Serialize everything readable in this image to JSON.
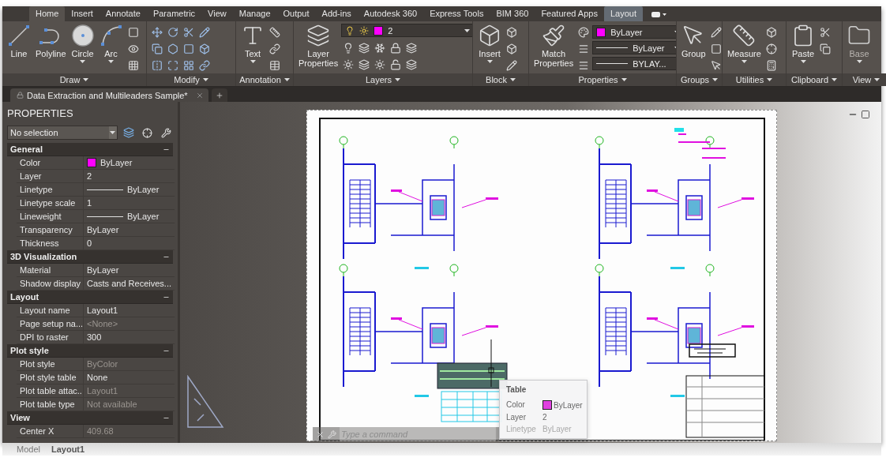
{
  "menu_tabs": [
    {
      "label": "Home",
      "selected": true,
      "kind": "standard"
    },
    {
      "label": "Insert",
      "selected": false,
      "kind": "standard"
    },
    {
      "label": "Annotate",
      "selected": false,
      "kind": "standard"
    },
    {
      "label": "Parametric",
      "selected": false,
      "kind": "standard"
    },
    {
      "label": "View",
      "selected": false,
      "kind": "standard"
    },
    {
      "label": "Manage",
      "selected": false,
      "kind": "standard"
    },
    {
      "label": "Output",
      "selected": false,
      "kind": "standard"
    },
    {
      "label": "Add-ins",
      "selected": false,
      "kind": "standard"
    },
    {
      "label": "Autodesk 360",
      "selected": false,
      "kind": "standard"
    },
    {
      "label": "Express Tools",
      "selected": false,
      "kind": "standard"
    },
    {
      "label": "BIM 360",
      "selected": false,
      "kind": "standard"
    },
    {
      "label": "Featured Apps",
      "selected": false,
      "kind": "standard"
    },
    {
      "label": "Layout",
      "selected": false,
      "kind": "contextual"
    }
  ],
  "ribbon_panels": [
    {
      "title": "Draw",
      "tools": [
        {
          "label": "Line"
        },
        {
          "label": "Polyline"
        },
        {
          "label": "Circle",
          "dropdown": true
        },
        {
          "label": "Arc",
          "dropdown": true
        }
      ]
    },
    {
      "title": "Modify"
    },
    {
      "title": "Annotation",
      "tools": [
        {
          "label": "Text",
          "dropdown": true
        }
      ]
    },
    {
      "title": "Layers",
      "tools": [
        {
          "label": "Layer Properties"
        }
      ],
      "layer_dropdown": {
        "value": "2",
        "color": "#ff00ff"
      }
    },
    {
      "title": "Block",
      "tools": [
        {
          "label": "Insert",
          "dropdown": true
        }
      ]
    },
    {
      "title": "Properties",
      "tools": [
        {
          "label": "Match Properties"
        }
      ],
      "dropdowns": [
        {
          "kind": "color",
          "value": "ByLayer",
          "color": "#ff00ff"
        },
        {
          "kind": "line",
          "value": "ByLayer"
        },
        {
          "kind": "line",
          "value": "BYLAY..."
        }
      ]
    },
    {
      "title": "Groups",
      "tools": [
        {
          "label": "Group"
        }
      ]
    },
    {
      "title": "Utilities",
      "tools": [
        {
          "label": "Measure",
          "dropdown": true
        }
      ]
    },
    {
      "title": "Clipboard",
      "tools": [
        {
          "label": "Paste",
          "dropdown": true
        }
      ]
    },
    {
      "title": "View",
      "tools": [
        {
          "label": "Base",
          "dropdown": true
        }
      ]
    }
  ],
  "document_tabs": [
    {
      "label": "Data Extraction and Multileaders Sample*",
      "selected": true
    }
  ],
  "properties": {
    "title": "PROPERTIES",
    "selection": "No selection",
    "sections": [
      {
        "title": "General",
        "expanded": true,
        "rows": [
          {
            "name": "Color",
            "value": "ByLayer",
            "kind": "color",
            "color": "#ff00ff",
            "disabled": false
          },
          {
            "name": "Layer",
            "value": "2",
            "kind": "text",
            "disabled": false
          },
          {
            "name": "Linetype",
            "value": "ByLayer",
            "kind": "line",
            "disabled": false
          },
          {
            "name": "Linetype scale",
            "value": "1",
            "kind": "text",
            "disabled": false
          },
          {
            "name": "Lineweight",
            "value": "ByLayer",
            "kind": "line",
            "disabled": false
          },
          {
            "name": "Transparency",
            "value": "ByLayer",
            "kind": "text",
            "disabled": false
          },
          {
            "name": "Thickness",
            "value": "0",
            "kind": "text",
            "disabled": false
          }
        ]
      },
      {
        "title": "3D Visualization",
        "expanded": true,
        "rows": [
          {
            "name": "Material",
            "value": "ByLayer",
            "kind": "text",
            "disabled": false
          },
          {
            "name": "Shadow display",
            "value": "Casts and Receives...",
            "kind": "text",
            "disabled": false
          }
        ]
      },
      {
        "title": "Layout",
        "expanded": true,
        "rows": [
          {
            "name": "Layout name",
            "value": "Layout1",
            "kind": "text",
            "disabled": false
          },
          {
            "name": "Page setup na...",
            "value": "<None>",
            "kind": "text",
            "disabled": true
          },
          {
            "name": "DPI to raster",
            "value": "300",
            "kind": "text",
            "disabled": false
          }
        ]
      },
      {
        "title": "Plot style",
        "expanded": true,
        "rows": [
          {
            "name": "Plot style",
            "value": "ByColor",
            "kind": "text",
            "disabled": true
          },
          {
            "name": "Plot style table",
            "value": "None",
            "kind": "text",
            "disabled": false
          },
          {
            "name": "Plot table attac...",
            "value": "Layout1",
            "kind": "text",
            "disabled": true
          },
          {
            "name": "Plot table type",
            "value": "Not available",
            "kind": "text",
            "disabled": true
          }
        ]
      },
      {
        "title": "View",
        "expanded": true,
        "rows": [
          {
            "name": "Center X",
            "value": "409.68",
            "kind": "text",
            "disabled": true
          }
        ]
      }
    ]
  },
  "tooltip": {
    "title": "Table",
    "rows": [
      {
        "name": "Color",
        "value": "ByLayer",
        "kind": "color",
        "color": "#e040e0"
      },
      {
        "name": "Layer",
        "value": "2",
        "kind": "text"
      },
      {
        "name": "Linetype",
        "value": "ByLayer",
        "kind": "text"
      }
    ]
  },
  "command_line": {
    "placeholder": "Type a command"
  },
  "layout_tabs": [
    {
      "label": "Model",
      "selected": false
    },
    {
      "label": "Layout1",
      "selected": true
    }
  ]
}
